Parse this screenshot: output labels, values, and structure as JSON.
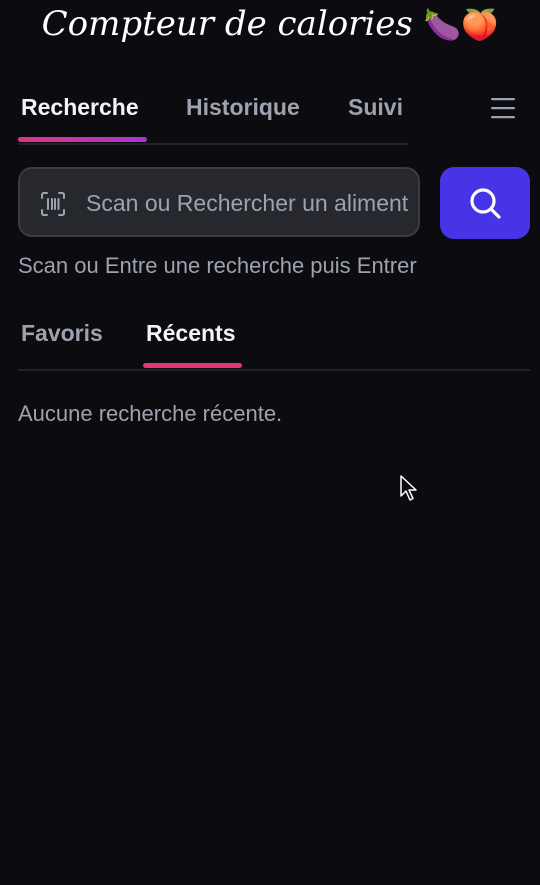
{
  "header": {
    "title": "Compteur de calories",
    "emojis": "🍆🍑"
  },
  "main_tabs": [
    {
      "label": "Recherche",
      "active": true
    },
    {
      "label": "Historique",
      "active": false
    },
    {
      "label": "Suivi",
      "active": false
    }
  ],
  "menu_icon": "hamburger-menu-icon",
  "search": {
    "placeholder": "Scan ou Rechercher un aliment",
    "value": "",
    "scan_icon": "barcode-scan-icon",
    "button_icon": "search-icon",
    "hint": "Scan ou Entre une recherche puis Entrer"
  },
  "sub_tabs": [
    {
      "label": "Favoris",
      "active": false
    },
    {
      "label": "Récents",
      "active": true
    }
  ],
  "recent": {
    "empty_message": "Aucune recherche récente."
  },
  "colors": {
    "background": "#0b0b10",
    "accent": "#4634e6",
    "tab_underline_start": "#e0357f",
    "tab_underline_end": "#a736d6",
    "subtab_underline": "#e8357a",
    "input_background": "#27272e"
  }
}
